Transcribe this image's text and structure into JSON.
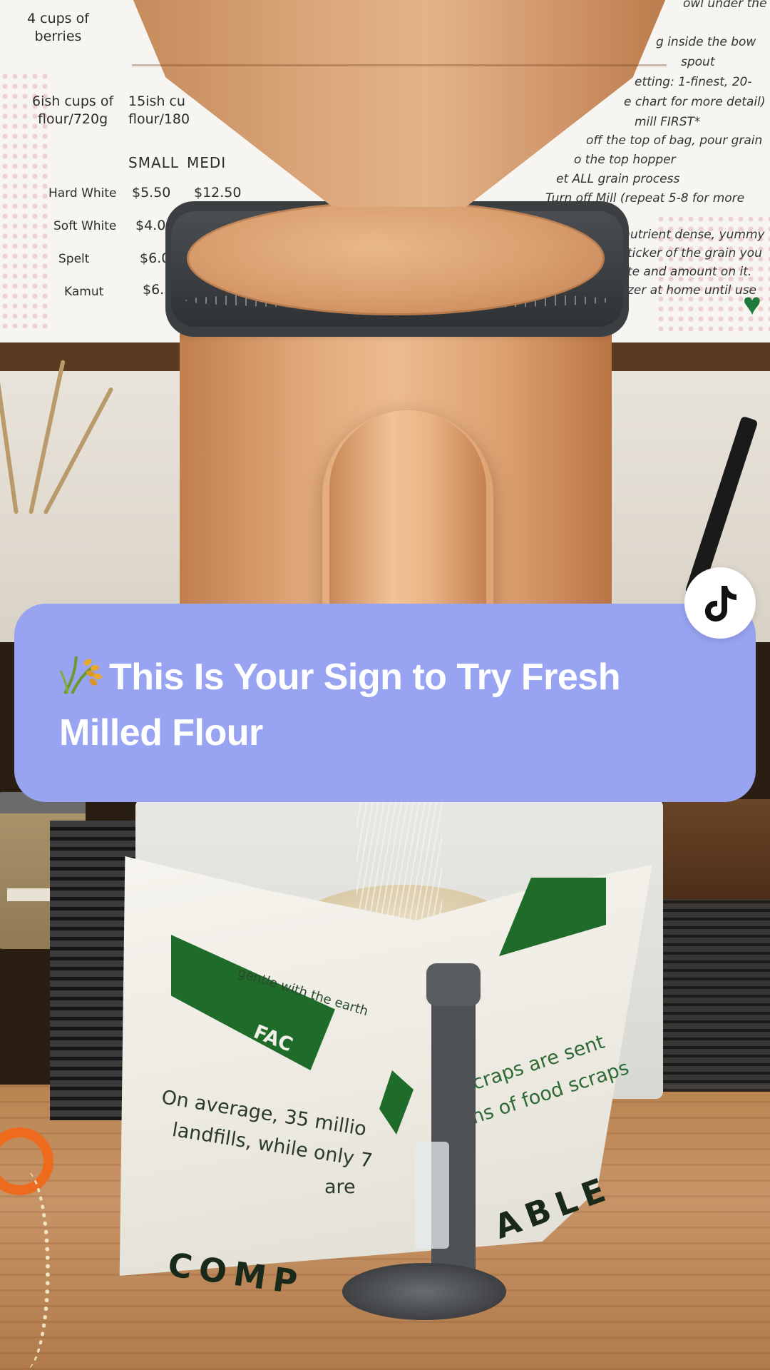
{
  "price_board": {
    "top_left_lines": [
      "4 cups of",
      "berries"
    ],
    "top_right_line": "owl under the",
    "yield_small": [
      "6ish cups of",
      "flour/720g"
    ],
    "yield_medium": [
      "15ish cu",
      "flour/180"
    ],
    "size_headers": [
      "SMALL",
      "MEDI"
    ],
    "rows": [
      {
        "grain": "Hard White",
        "small": "$5.50",
        "medium": "$12.50"
      },
      {
        "grain": "Soft White",
        "small": "$4.00",
        "medium": ""
      },
      {
        "grain": "Spelt",
        "small": "$6.0",
        "medium": ""
      },
      {
        "grain": "Kamut",
        "small": "$6.",
        "medium": ""
      }
    ],
    "instructions": [
      "g inside the bow",
      "spout",
      "etting: 1-finest, 20-",
      "e chart for more detail)",
      "mill FIRST*",
      "off the top of bag, pour grain",
      "o the top hopper",
      "et ALL grain process",
      "Turn off Mill (repeat 5-8 for more",
      "ur nutrient dense, yummy",
      "ticker of the grain you",
      "te and amount on it.",
      "zer at home until use"
    ]
  },
  "bag": {
    "slogan": "gentle with the earth",
    "brand_fragment": "FAC",
    "line1": "On average, 35 millio",
    "line1_right": "d scraps are sent",
    "line2": "landfills, while only 7",
    "line2_right": "tons of food scraps",
    "line3": "are",
    "compostable_left": "COMP",
    "compostable_right": "ABLE"
  },
  "caption": {
    "emoji_icon": "rice-stalk-icon",
    "text": "This Is Your Sign to Try Fresh Milled Flour",
    "background": "#98a4f1",
    "text_color": "#ffffff"
  },
  "platform": {
    "logo_icon": "tiktok-logo-icon"
  }
}
